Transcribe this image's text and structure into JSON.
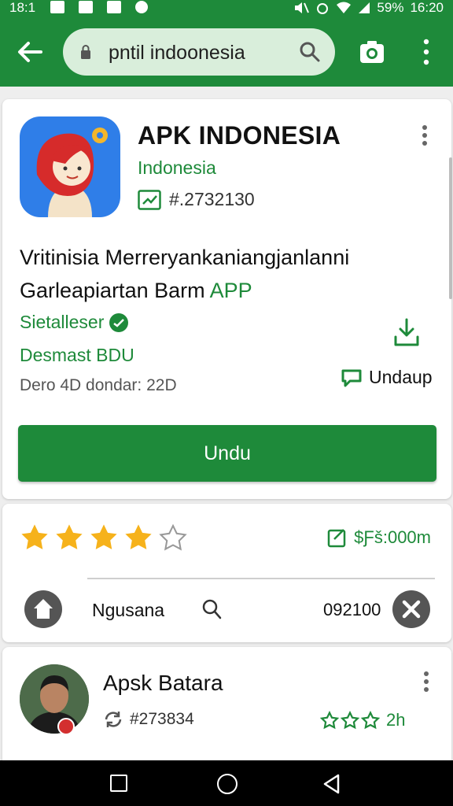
{
  "status_bar": {
    "time_left": "18:1",
    "battery": "59%",
    "time": "16:20"
  },
  "toolbar": {
    "search_value": "pntil indoonesia"
  },
  "app": {
    "title": "APK INDONESIA",
    "subtitle": "Indonesia",
    "trend_id": "#.2732130",
    "desc_line1": "Vritinisia Merreryankaniangjanlanni",
    "desc_line2_prefix": "Garleapiartan Barm ",
    "desc_line2_accent": "APP",
    "seller": "Sietalleser",
    "desmast": "Desmast BDU",
    "date": "Dero 4D dondar: 22D",
    "undaup_label": "Undaup",
    "primary_button": "Undu"
  },
  "rating": {
    "value": 4,
    "max": 5,
    "stat": "$Ƒš:000m",
    "mid_label": "Ngusana",
    "mid_num": "092100"
  },
  "review": {
    "name": "Apsk Batara",
    "id": "#273834",
    "stars": 3,
    "time": "2h"
  },
  "colors": {
    "brand_green": "#1e8a3a",
    "star_gold": "#f6b21b"
  }
}
